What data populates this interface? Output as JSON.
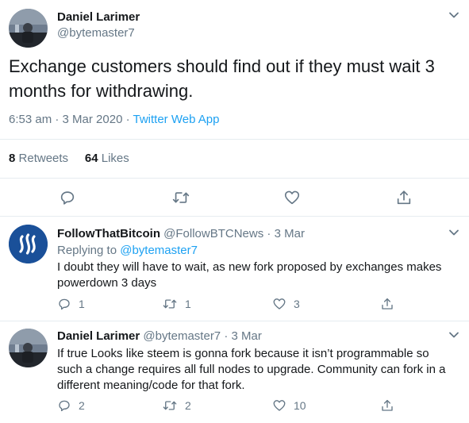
{
  "main_tweet": {
    "author_name": "Daniel Larimer",
    "author_handle": "@bytemaster7",
    "text": "Exchange customers should find out if they must wait 3 months for withdrawing.",
    "time": "6:53 am",
    "date": "3 Mar 2020",
    "separator": " · ",
    "source": "Twitter Web App",
    "retweets_count": "8",
    "retweets_label": "Retweets",
    "likes_count": "64",
    "likes_label": "Likes"
  },
  "replies": [
    {
      "author_name": "FollowThatBitcoin",
      "author_handle": "@FollowBTCNews",
      "date": "3 Mar",
      "replying_prefix": "Replying to ",
      "replying_to": "@bytemaster7",
      "text": "I doubt they will have to wait, as new fork proposed by exchanges makes powerdown 3 days",
      "reply_count": "1",
      "retweet_count": "1",
      "like_count": "3"
    },
    {
      "author_name": "Daniel Larimer",
      "author_handle": "@bytemaster7",
      "date": "3 Mar",
      "text": "If true Looks like steem is gonna fork because it isn’t programmable so such a change requires all full nodes to upgrade. Community can fork in a different meaning/code for that fork.",
      "reply_count": "2",
      "retweet_count": "2",
      "like_count": "10"
    }
  ],
  "icons": {
    "caret": "chevron-down-icon",
    "reply": "reply-icon",
    "retweet": "retweet-icon",
    "like": "heart-icon",
    "share": "share-icon"
  },
  "colors": {
    "accent": "#1da1f2",
    "text": "#14171a",
    "secondary": "#657786",
    "divider": "#e6ecf0",
    "steem_badge": "#1a5099"
  }
}
